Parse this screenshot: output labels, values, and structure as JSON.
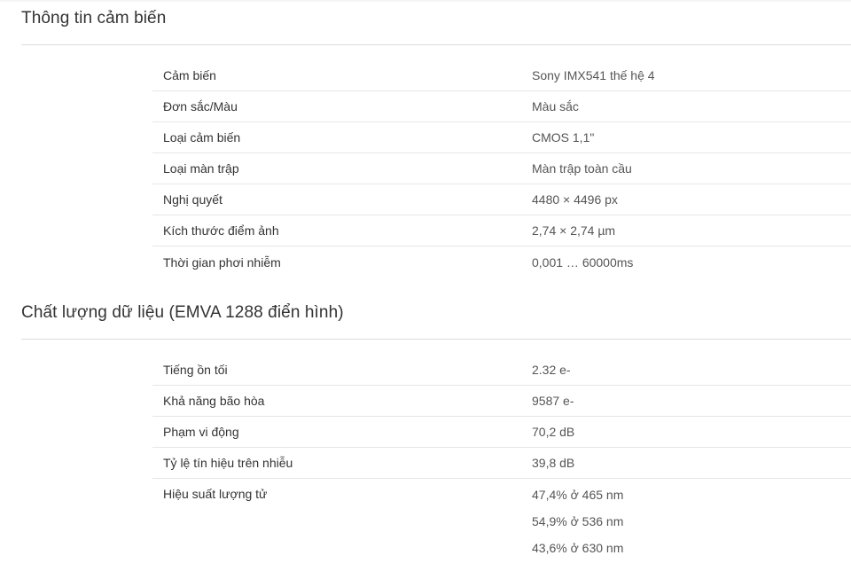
{
  "sections": [
    {
      "title": "Thông tin cảm biến",
      "rows": [
        {
          "label": "Cảm biến",
          "value": "Sony IMX541 thế hệ 4"
        },
        {
          "label": "Đơn sắc/Màu",
          "value": "Màu sắc"
        },
        {
          "label": "Loại cảm biến",
          "value": "CMOS 1,1\""
        },
        {
          "label": "Loại màn trập",
          "value": "Màn trập toàn cầu"
        },
        {
          "label": "Nghị quyết",
          "value": "4480 × 4496 px"
        },
        {
          "label": "Kích thước điểm ảnh",
          "value": "2,74 × 2,74 µm"
        },
        {
          "label": "Thời gian phơi nhiễm",
          "value": "0,001 … 60000ms"
        }
      ]
    },
    {
      "title": "Chất lượng dữ liệu (EMVA 1288 điển hình)",
      "rows": [
        {
          "label": "Tiếng ồn tối",
          "value": "2.32 e-"
        },
        {
          "label": "Khả năng bão hòa",
          "value": "9587 e-"
        },
        {
          "label": "Phạm vi động",
          "value": "70,2 dB"
        },
        {
          "label": "Tỷ lệ tín hiệu trên nhiễu",
          "value": "39,8 dB"
        }
      ],
      "multi_row": {
        "label": "Hiệu suất lượng tử",
        "values": [
          "47,4% ở 465 nm",
          "54,9% ở 536 nm",
          "43,6% ở 630 nm"
        ]
      }
    }
  ]
}
